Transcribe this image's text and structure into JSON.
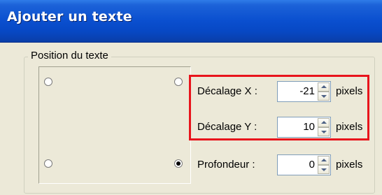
{
  "dialog": {
    "title": "Ajouter un texte",
    "group_label": "Position du texte",
    "positions": [
      {
        "id": "top-left",
        "checked": false
      },
      {
        "id": "top-right",
        "checked": false
      },
      {
        "id": "bottom-left",
        "checked": false
      },
      {
        "id": "bottom-right",
        "checked": true
      }
    ],
    "fields": {
      "offset_x": {
        "label": "Décalage X :",
        "value": "-21",
        "unit": "pixels"
      },
      "offset_y": {
        "label": "Décalage Y :",
        "value": "10",
        "unit": "pixels"
      },
      "depth": {
        "label": "Profondeur :",
        "value": "0",
        "unit": "pixels"
      }
    }
  },
  "colors": {
    "titlebar": "#0a4fcf",
    "dialog_bg": "#ece9d8",
    "highlight": "#e8141c"
  }
}
